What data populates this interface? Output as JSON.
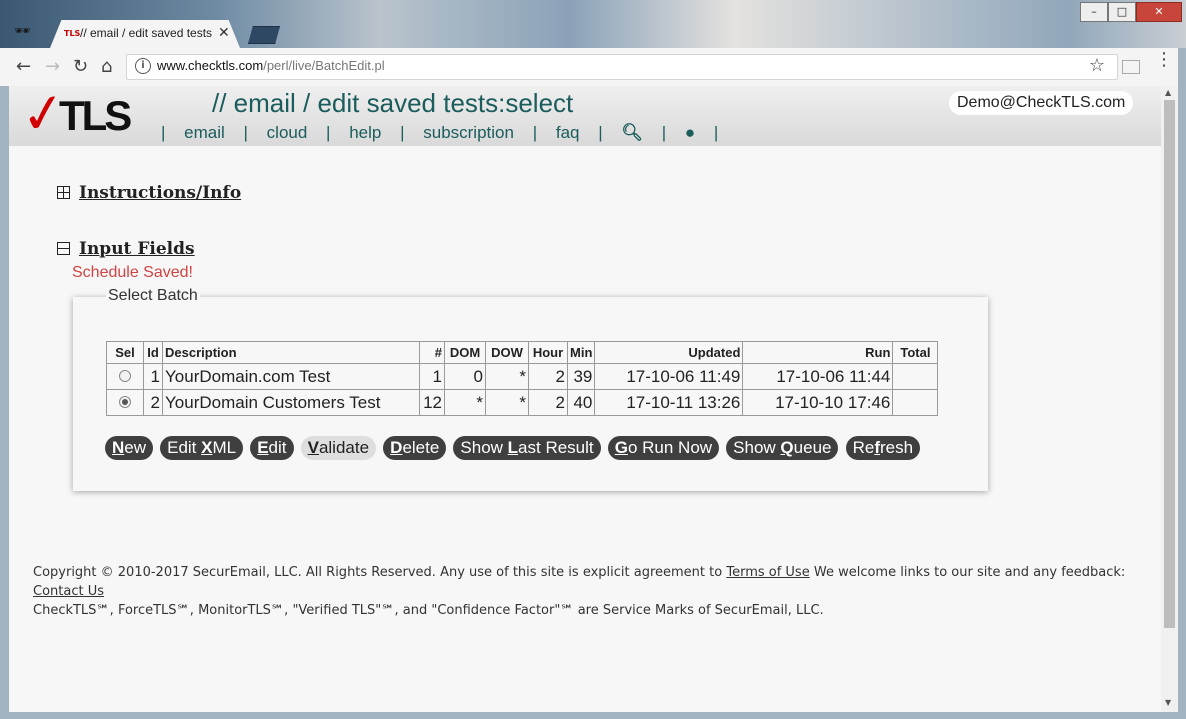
{
  "browser": {
    "tab_title": "// email / edit saved tests:select",
    "tab_favicon_text": "TLS",
    "url_host": "www.checktls.com",
    "url_path": "/perl/live/BatchEdit.pl"
  },
  "header": {
    "logo_text": "TLS",
    "page_heading": "// email / edit saved tests:select",
    "user": "Demo@CheckTLS.com",
    "nav": [
      {
        "label": "email"
      },
      {
        "label": "cloud"
      },
      {
        "label": "help"
      },
      {
        "label": "subscription"
      },
      {
        "label": "faq"
      }
    ],
    "search_icon": "search-icon",
    "globe_icon": "globe-icon"
  },
  "sections": {
    "instructions": "Instructions/Info",
    "input_fields": "Input Fields"
  },
  "status_message": "Schedule Saved!",
  "batch_panel": {
    "legend": "Select Batch",
    "columns": [
      "Sel",
      "Id",
      "Description",
      "#",
      "DOM",
      "DOW",
      "Hour",
      "Min",
      "Updated",
      "Run",
      "Total"
    ],
    "rows": [
      {
        "selected": false,
        "id": "1",
        "description": "YourDomain.com Test",
        "count": "1",
        "dom": "0",
        "dow": "*",
        "hour": "2",
        "min": "39",
        "updated": "17-10-06 11:49",
        "run": "17-10-06 11:44",
        "total": ""
      },
      {
        "selected": true,
        "id": "2",
        "description": "YourDomain Customers Test",
        "count": "12",
        "dom": "*",
        "dow": "*",
        "hour": "2",
        "min": "40",
        "updated": "17-10-11 13:26",
        "run": "17-10-10 17:46",
        "total": ""
      }
    ],
    "buttons": [
      {
        "pre": "",
        "key": "N",
        "post": "ew"
      },
      {
        "pre": "Edit ",
        "key": "X",
        "post": "ML"
      },
      {
        "pre": "",
        "key": "E",
        "post": "dit"
      },
      {
        "pre": "",
        "key": "V",
        "post": "alidate"
      },
      {
        "pre": "",
        "key": "D",
        "post": "elete"
      },
      {
        "pre": "Show ",
        "key": "L",
        "post": "ast Result"
      },
      {
        "pre": "",
        "key": "G",
        "post": "o Run Now"
      },
      {
        "pre": "Show ",
        "key": "Q",
        "post": "ueue"
      },
      {
        "pre": "Re",
        "key": "f",
        "post": "resh"
      }
    ]
  },
  "footer": {
    "copyright": "Copyright © 2010-2017 SecurEmail, LLC. All Rights Reserved. Any use of this site is explicit agreement to",
    "terms_link": "Terms of Use",
    "welcome": "We welcome links to our site and any feedback:",
    "contact_link": "Contact Us",
    "marks": "CheckTLS℠, ForceTLS℠, MonitorTLS℠, \"Verified TLS\"℠, and \"Confidence Factor\"℠ are Service Marks of SecurEmail, LLC."
  }
}
